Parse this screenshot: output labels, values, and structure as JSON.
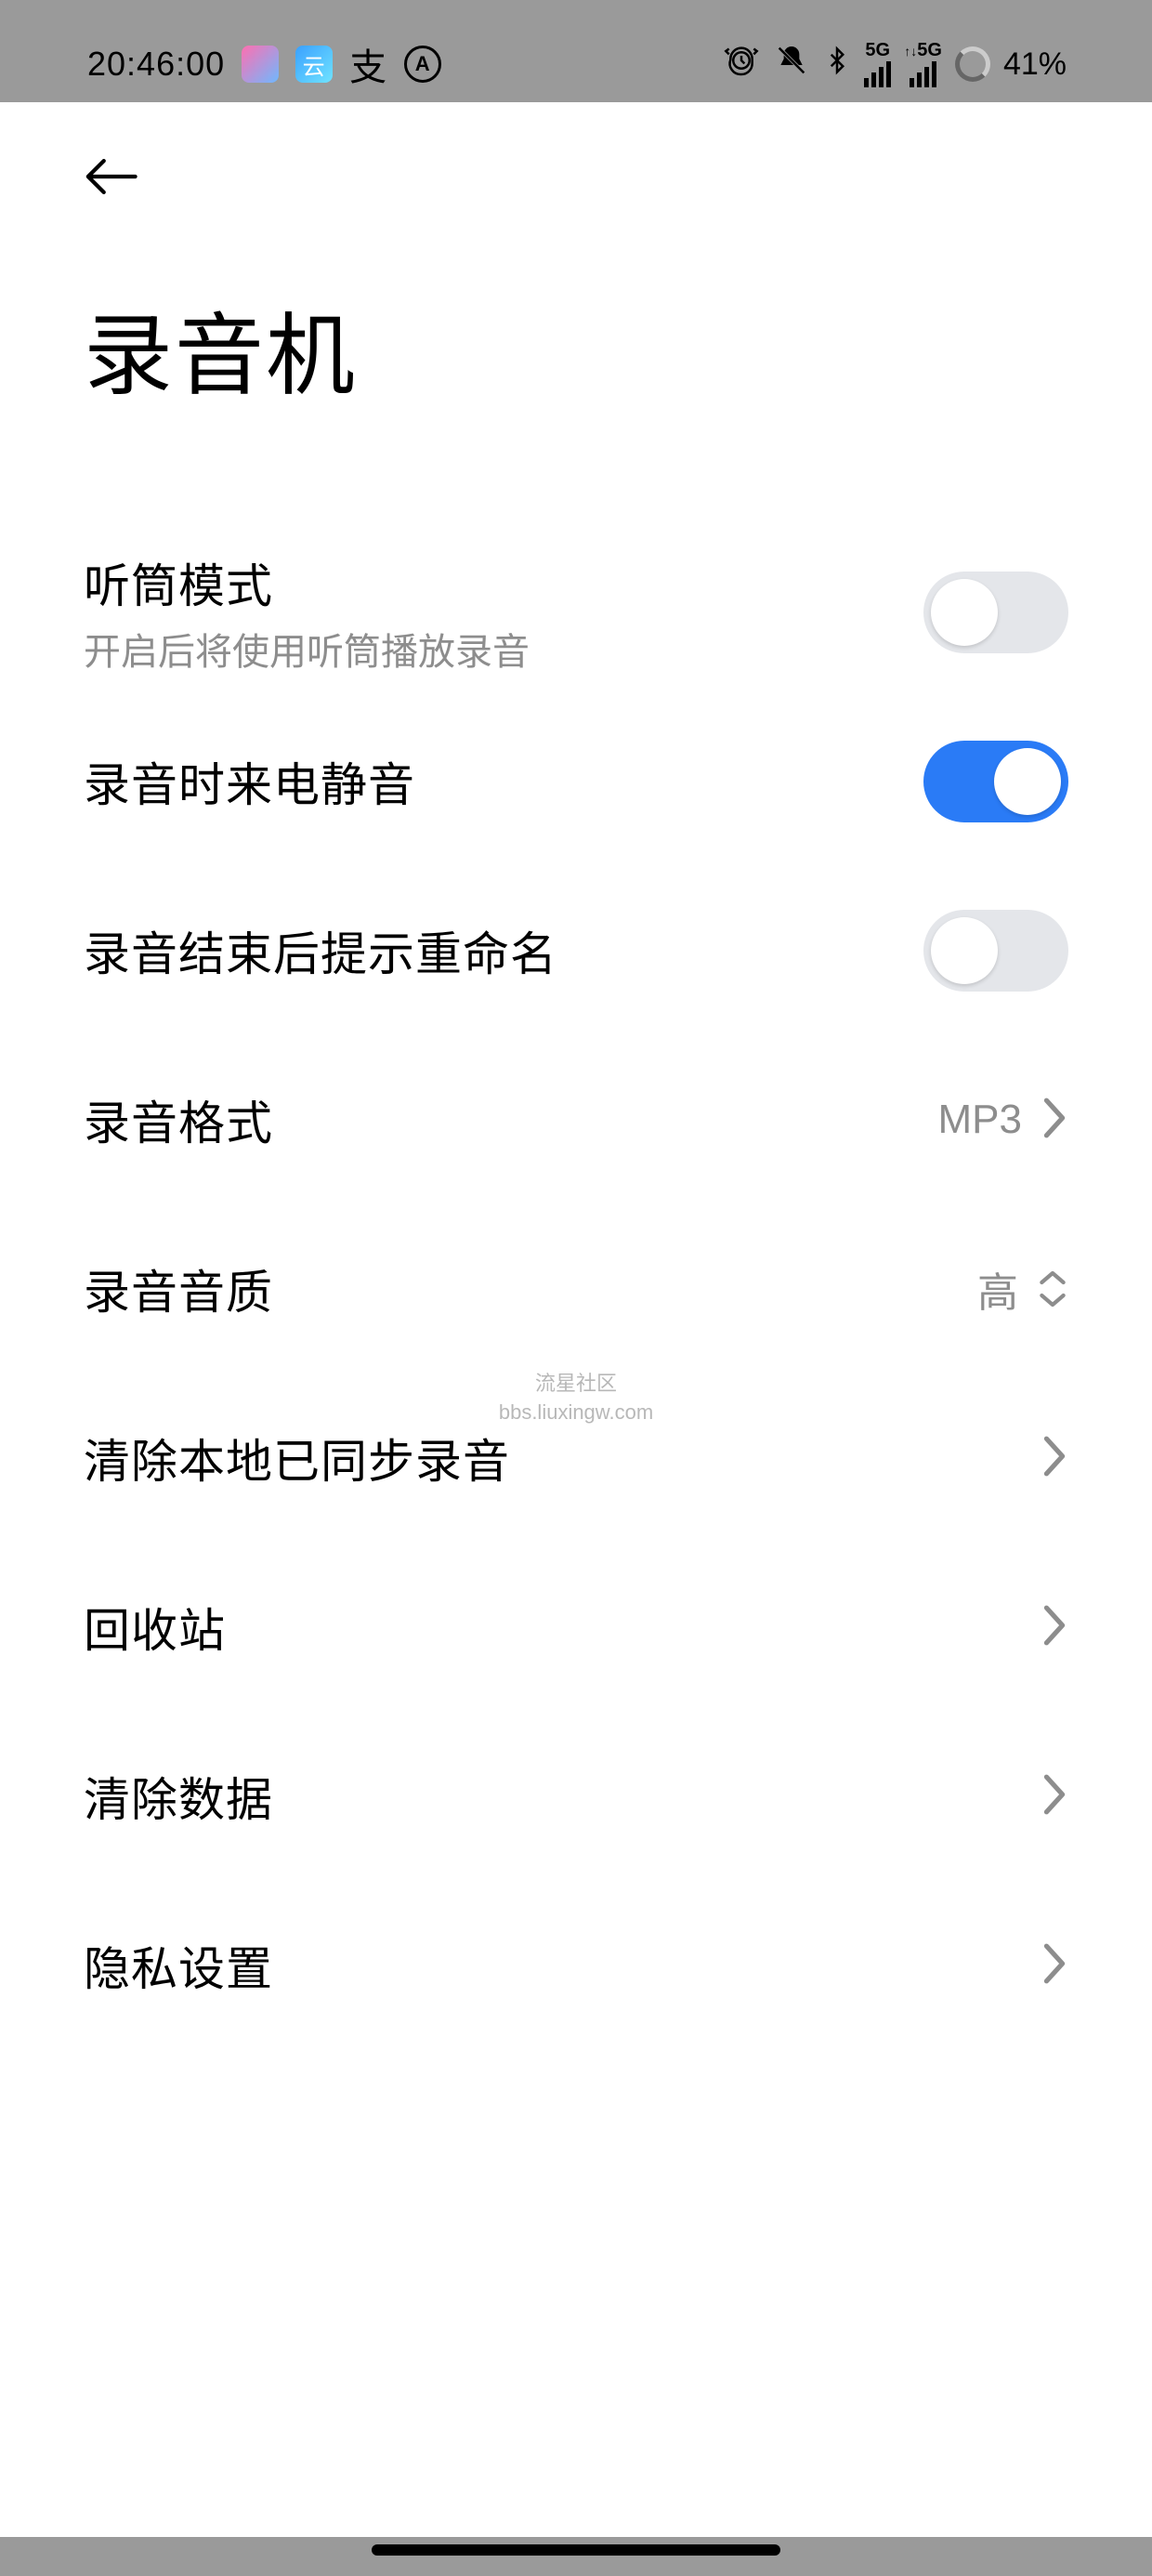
{
  "status": {
    "time": "20:46:00",
    "battery": "41%",
    "net_label_1": "5G",
    "net_label_2": "5G",
    "zhi": "支"
  },
  "page": {
    "title": "录音机"
  },
  "rows": {
    "earpiece": {
      "title": "听筒模式",
      "sub": "开启后将使用听筒播放录音",
      "on": false
    },
    "mute_call": {
      "title": "录音时来电静音",
      "on": true
    },
    "rename_prompt": {
      "title": "录音结束后提示重命名",
      "on": false
    },
    "format": {
      "title": "录音格式",
      "value": "MP3"
    },
    "quality": {
      "title": "录音音质",
      "value": "高"
    },
    "clear_synced": {
      "title": "清除本地已同步录音"
    },
    "recycle": {
      "title": "回收站"
    },
    "clear_data": {
      "title": "清除数据"
    },
    "privacy": {
      "title": "隐私设置"
    }
  },
  "watermark": {
    "line1": "流星社区",
    "line2": "bbs.liuxingw.com"
  }
}
